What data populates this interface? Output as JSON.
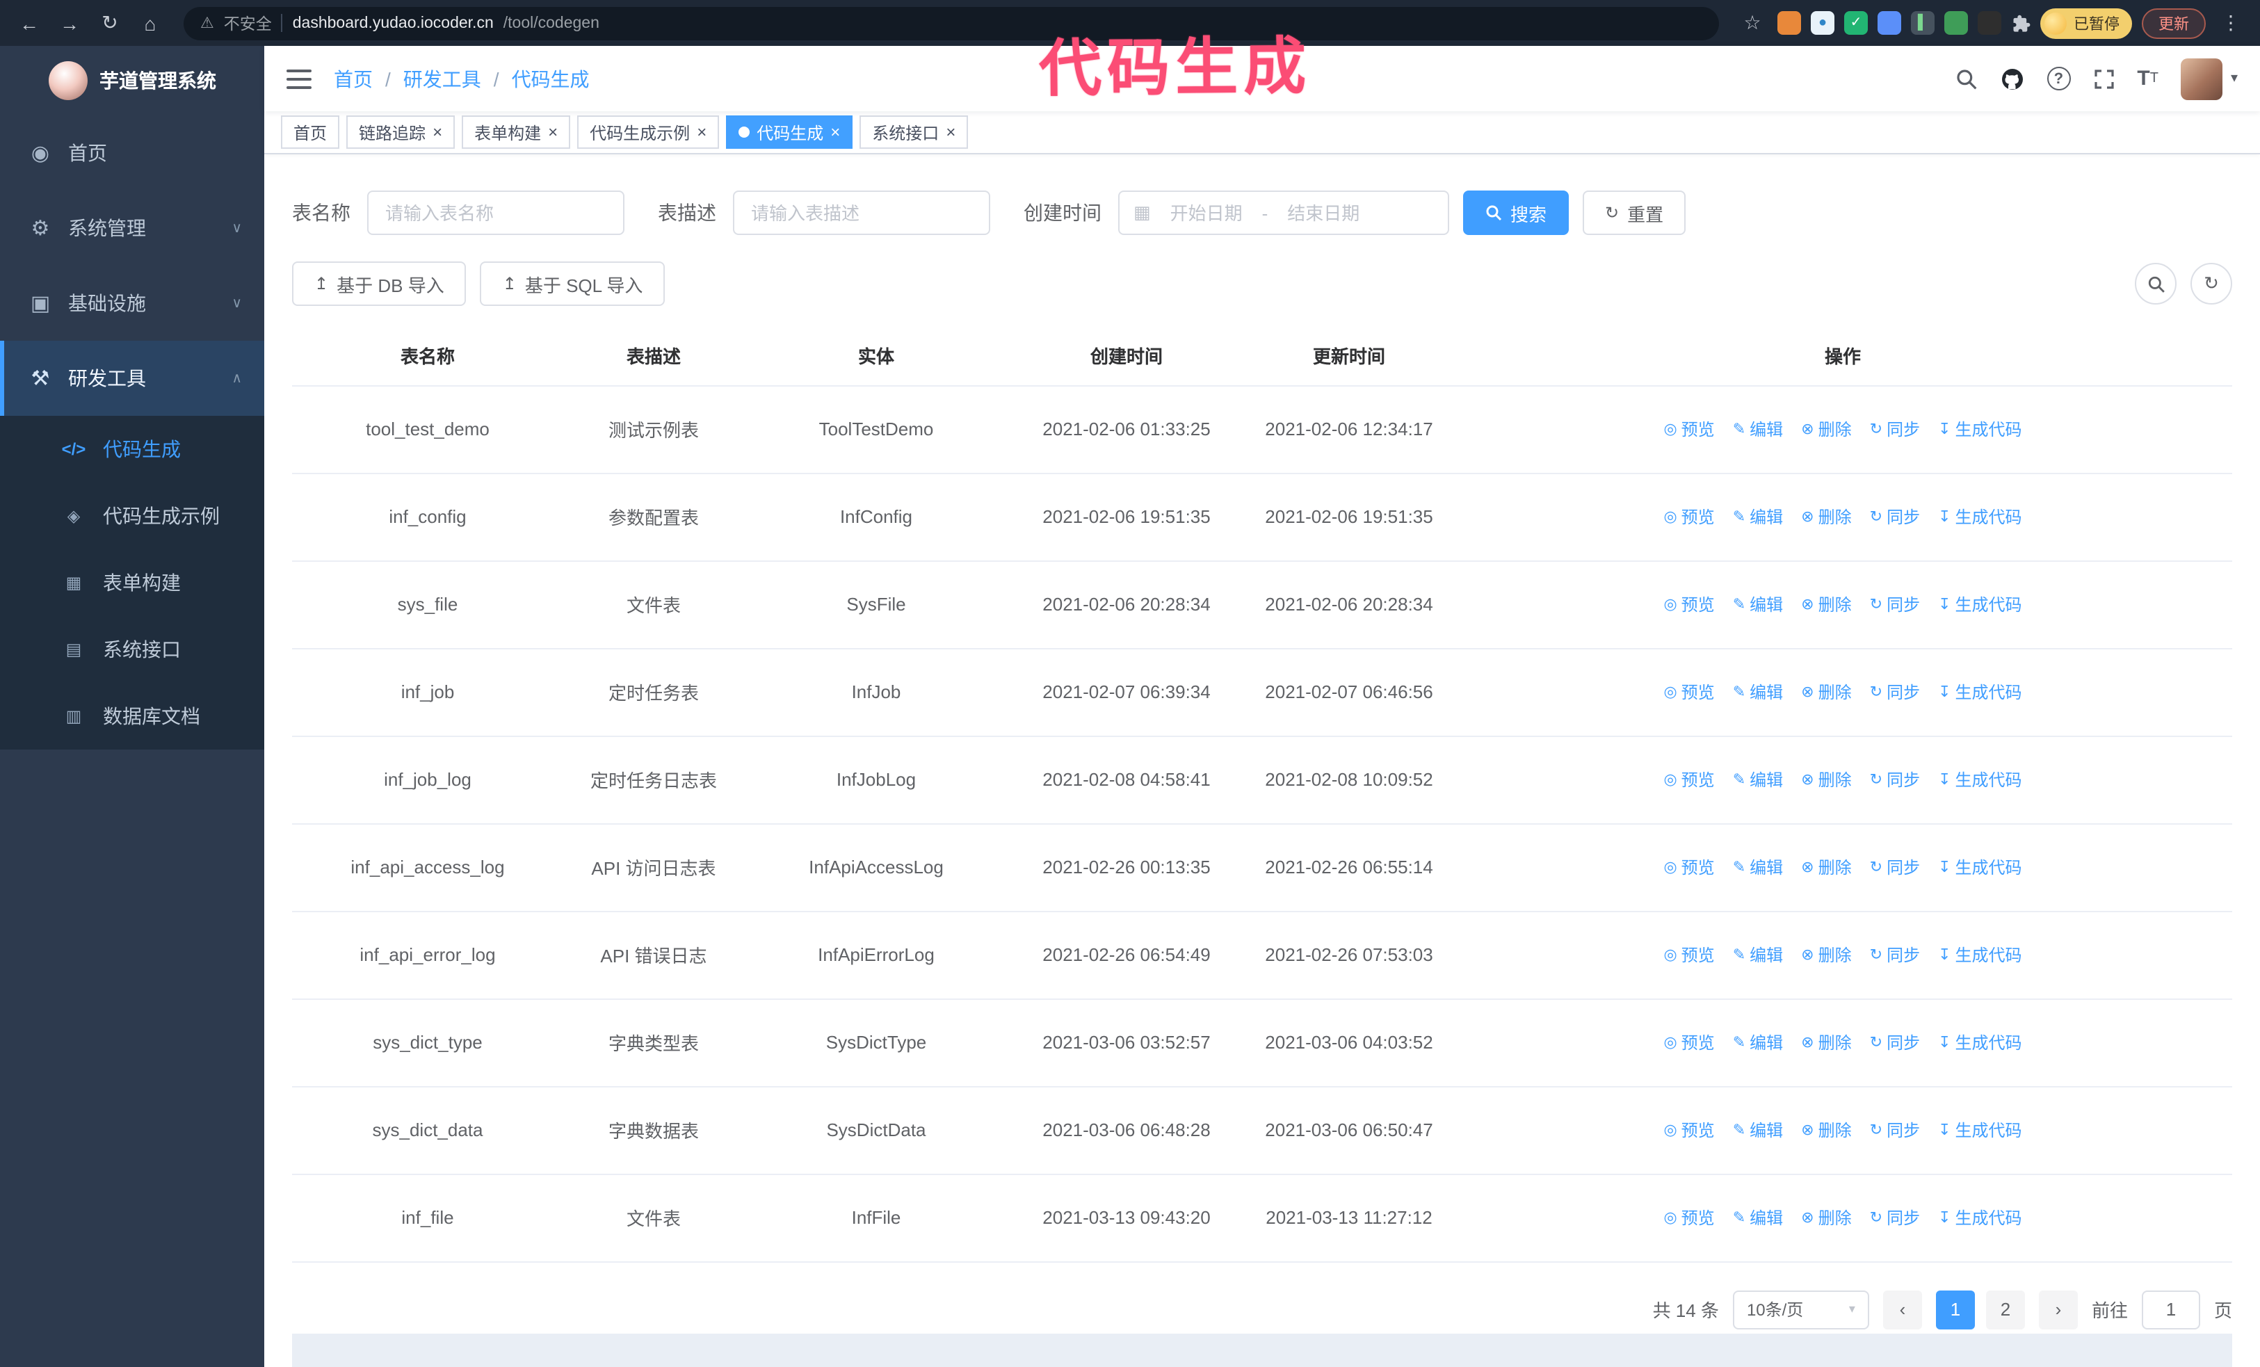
{
  "annotation": {
    "text": "代码生成",
    "color": "#fb4d75"
  },
  "browser": {
    "security_label": "不安全",
    "url_host": "dashboard.yudao.iocoder.cn",
    "url_path": "/tool/codegen",
    "profile_chip": "已暂停",
    "update_button": "更新",
    "extensions": [
      {
        "name": "extension-orange",
        "style": "background:#e8883a",
        "letter": ""
      },
      {
        "name": "extension-water-drop",
        "style": "background:#e9f3fa;color:#2f86c8",
        "letter": "●"
      },
      {
        "name": "extension-green-check",
        "style": "background:#22b573",
        "letter": "✓"
      },
      {
        "name": "extension-blue-users",
        "style": "background:#5b8ff9",
        "letter": ""
      },
      {
        "name": "extension-slate-card",
        "style": "background:#46525e;color:#7bd88f",
        "letter": "▌"
      },
      {
        "name": "extension-green-leaf",
        "style": "background:#3f9d58",
        "letter": ""
      },
      {
        "name": "extension-dark",
        "style": "background:#2e2e2e",
        "letter": ""
      }
    ]
  },
  "sidebar": {
    "logo_title": "芋道管理系统",
    "items": [
      {
        "label": "首页",
        "icon": "home",
        "expandable": false,
        "expanded": false,
        "active": false
      },
      {
        "label": "系统管理",
        "icon": "gear",
        "expandable": true,
        "expanded": false,
        "active": false,
        "chevron": "chevDown"
      },
      {
        "label": "基础设施",
        "icon": "infra",
        "expandable": true,
        "expanded": false,
        "active": false,
        "chevron": "chevDown"
      },
      {
        "label": "研发工具",
        "icon": "tools",
        "expandable": true,
        "expanded": true,
        "active": true,
        "chevron": "chevUp"
      }
    ],
    "subitems": [
      {
        "label": "代码生成",
        "icon": "code",
        "active": true
      },
      {
        "label": "代码生成示例",
        "icon": "example",
        "active": false
      },
      {
        "label": "表单构建",
        "icon": "form",
        "active": false
      },
      {
        "label": "系统接口",
        "icon": "api",
        "active": false
      },
      {
        "label": "数据库文档",
        "icon": "dbdoc",
        "active": false
      }
    ]
  },
  "breadcrumb": {
    "separator": "/",
    "items": [
      {
        "label": "首页",
        "sep": false
      },
      {
        "label": "研发工具",
        "sep": true
      },
      {
        "label": "代码生成",
        "sep": true
      }
    ]
  },
  "tabs": [
    {
      "label": "首页",
      "closable": false,
      "active": false
    },
    {
      "label": "链路追踪",
      "closable": true,
      "active": false
    },
    {
      "label": "表单构建",
      "closable": true,
      "active": false
    },
    {
      "label": "代码生成示例",
      "closable": true,
      "active": false
    },
    {
      "label": "代码生成",
      "closable": true,
      "active": true
    },
    {
      "label": "系统接口",
      "closable": true,
      "active": false
    }
  ],
  "filters": {
    "name_label": "表名称",
    "name_placeholder": "请输入表名称",
    "desc_label": "表描述",
    "desc_placeholder": "请输入表描述",
    "time_label": "创建时间",
    "start_placeholder": "开始日期",
    "range_separator": "-",
    "end_placeholder": "结束日期",
    "search_label": "搜索",
    "reset_label": "重置"
  },
  "toolbar": {
    "import_db_label": "基于 DB 导入",
    "import_sql_label": "基于 SQL 导入"
  },
  "table": {
    "columns": [
      {
        "label": "表名称"
      },
      {
        "label": "表描述"
      },
      {
        "label": "实体"
      },
      {
        "label": "创建时间"
      },
      {
        "label": "更新时间"
      },
      {
        "label": "操作"
      }
    ],
    "actions": [
      {
        "label": "预览",
        "icon": "eye"
      },
      {
        "label": "编辑",
        "icon": "edit"
      },
      {
        "label": "删除",
        "icon": "trash"
      },
      {
        "label": "同步",
        "icon": "sync"
      },
      {
        "label": "生成代码",
        "icon": "download"
      }
    ],
    "rows": [
      {
        "name": "tool_test_demo",
        "desc": "测试示例表",
        "entity": "ToolTestDemo",
        "created": "2021-02-06 01:33:25",
        "updated": "2021-02-06 12:34:17"
      },
      {
        "name": "inf_config",
        "desc": "参数配置表",
        "entity": "InfConfig",
        "created": "2021-02-06 19:51:35",
        "updated": "2021-02-06 19:51:35"
      },
      {
        "name": "sys_file",
        "desc": "文件表",
        "entity": "SysFile",
        "created": "2021-02-06 20:28:34",
        "updated": "2021-02-06 20:28:34"
      },
      {
        "name": "inf_job",
        "desc": "定时任务表",
        "entity": "InfJob",
        "created": "2021-02-07 06:39:34",
        "updated": "2021-02-07 06:46:56"
      },
      {
        "name": "inf_job_log",
        "desc": "定时任务日志表",
        "entity": "InfJobLog",
        "created": "2021-02-08 04:58:41",
        "updated": "2021-02-08 10:09:52"
      },
      {
        "name": "inf_api_access_log",
        "desc": "API 访问日志表",
        "entity": "InfApiAccessLog",
        "created": "2021-02-26 00:13:35",
        "updated": "2021-02-26 06:55:14"
      },
      {
        "name": "inf_api_error_log",
        "desc": "API 错误日志",
        "entity": "InfApiErrorLog",
        "created": "2021-02-26 06:54:49",
        "updated": "2021-02-26 07:53:03"
      },
      {
        "name": "sys_dict_type",
        "desc": "字典类型表",
        "entity": "SysDictType",
        "created": "2021-03-06 03:52:57",
        "updated": "2021-03-06 04:03:52"
      },
      {
        "name": "sys_dict_data",
        "desc": "字典数据表",
        "entity": "SysDictData",
        "created": "2021-03-06 06:48:28",
        "updated": "2021-03-06 06:50:47"
      },
      {
        "name": "inf_file",
        "desc": "文件表",
        "entity": "InfFile",
        "created": "2021-03-13 09:43:20",
        "updated": "2021-03-13 11:27:12"
      }
    ]
  },
  "pagination": {
    "total_label": "共 14 条",
    "page_size_label": "10条/页",
    "pages": [
      {
        "label": "1",
        "active": true
      },
      {
        "label": "2",
        "active": false
      }
    ],
    "goto_label": "前往",
    "goto_value": "1",
    "goto_suffix": "页"
  },
  "colors": {
    "accent": "#409eff",
    "annotation": "#fb4d75",
    "sidebar_bg": "#2d3a4e",
    "submenu_bg": "#1f2d3d",
    "chrome_bg": "#1e2836"
  }
}
